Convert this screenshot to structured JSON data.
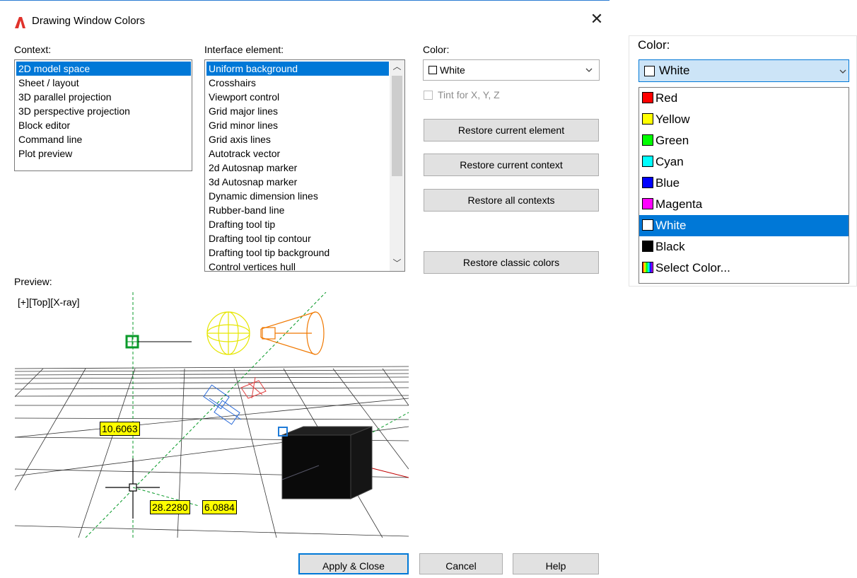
{
  "dialog": {
    "title": "Drawing Window Colors",
    "close_glyph": "✕"
  },
  "context": {
    "label": "Context:",
    "items": [
      "2D model space",
      "Sheet / layout",
      "3D parallel projection",
      "3D perspective projection",
      "Block editor",
      "Command line",
      "Plot preview"
    ],
    "selected": "2D model space"
  },
  "interface_element": {
    "label": "Interface element:",
    "items": [
      "Uniform background",
      "Crosshairs",
      "Viewport control",
      "Grid major lines",
      "Grid minor lines",
      "Grid axis lines",
      "Autotrack vector",
      "2d Autosnap marker",
      "3d Autosnap marker",
      "Dynamic dimension lines",
      "Rubber-band line",
      "Drafting tool tip",
      "Drafting tool tip contour",
      "Drafting tool tip background",
      "Control vertices hull"
    ],
    "selected": "Uniform background"
  },
  "color": {
    "label": "Color:",
    "value": "White",
    "tint_label": "Tint for X, Y, Z",
    "tint_checked": false
  },
  "buttons": {
    "restore_element": "Restore current element",
    "restore_context": "Restore current context",
    "restore_all": "Restore all contexts",
    "restore_classic": "Restore classic colors",
    "apply_close": "Apply & Close",
    "cancel": "Cancel",
    "help": "Help"
  },
  "preview": {
    "label": "Preview:",
    "viewport_label": "[+][Top][X-ray]",
    "dim_left": "10.6063",
    "dim_bottom_a": "28.2280",
    "dim_bottom_b": "6.0884"
  },
  "dropdown": {
    "label": "Color:",
    "value": "White",
    "options": [
      {
        "label": "Red",
        "color": "#ff0000"
      },
      {
        "label": "Yellow",
        "color": "#ffff00"
      },
      {
        "label": "Green",
        "color": "#00ff00"
      },
      {
        "label": "Cyan",
        "color": "#00ffff"
      },
      {
        "label": "Blue",
        "color": "#0000ff"
      },
      {
        "label": "Magenta",
        "color": "#ff00ff"
      },
      {
        "label": "White",
        "color": "#ffffff"
      },
      {
        "label": "Black",
        "color": "#000000"
      },
      {
        "label": "Select Color...",
        "color": "spectrum"
      }
    ],
    "selected": "White"
  },
  "accent": "#0078d7"
}
